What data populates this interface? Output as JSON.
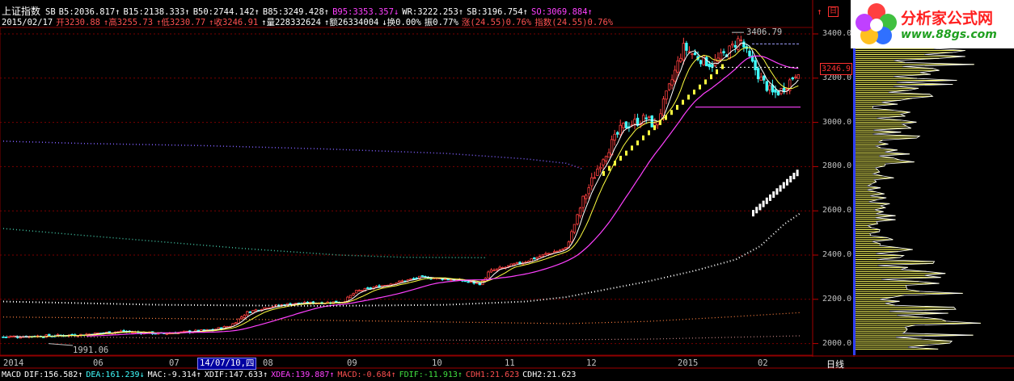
{
  "header": {
    "title": "上证指数",
    "sb_prefix": "SB",
    "items_row1": [
      {
        "label": "B5:2036.817↑",
        "color": "w"
      },
      {
        "label": "B15:2138.333↑",
        "color": "w"
      },
      {
        "label": "B50:2744.142↑",
        "color": "w"
      },
      {
        "label": "B85:3249.428↑",
        "color": "w"
      },
      {
        "label": "B95:3353.357↓",
        "color": "m"
      },
      {
        "label": "WR:3222.253↑",
        "color": "w"
      },
      {
        "label": "SB:3196.754↑",
        "color": "w"
      },
      {
        "label": "SO:3069.884↑",
        "color": "m"
      }
    ],
    "date": "2015/02/17",
    "items_row2": [
      {
        "label": "开3230.88",
        "color": "r"
      },
      {
        "label": "↑高3255.73",
        "color": "r"
      },
      {
        "label": "↑低3230.77",
        "color": "r"
      },
      {
        "label": "↑收3246.91",
        "color": "r"
      },
      {
        "label": "↑量228332624",
        "color": "w"
      },
      {
        "label": "↑额26334004",
        "color": "w"
      },
      {
        "label": "↓换0.00%",
        "color": "w"
      },
      {
        "label": "振0.77%",
        "color": "w"
      },
      {
        "label": "涨(24.55)0.76%",
        "color": "r"
      },
      {
        "label": "指数(24.55)0.76%",
        "color": "r"
      }
    ]
  },
  "controls": {
    "up_arrow": "↑",
    "box_glyph": "日"
  },
  "logo": {
    "title": "分析家公式网",
    "url": "www.88gs.com"
  },
  "y_axis": {
    "labels": [
      "3400.0",
      "3200.0",
      "3000.0",
      "2800.0",
      "2600.0",
      "2400.0",
      "2200.0",
      "2000.0"
    ]
  },
  "price_tag": "3246.9",
  "peak_label": "3406.79",
  "low_label": "1991.06",
  "x_axis": {
    "labels": [
      {
        "text": "2014",
        "pos": 4
      },
      {
        "text": "06",
        "pos": 115
      },
      {
        "text": "07",
        "pos": 209
      },
      {
        "text": "08",
        "pos": 325
      },
      {
        "text": "09",
        "pos": 429
      },
      {
        "text": "10",
        "pos": 534
      },
      {
        "text": "11",
        "pos": 624
      },
      {
        "text": "12",
        "pos": 725
      },
      {
        "text": "2015",
        "pos": 838
      },
      {
        "text": "02",
        "pos": 937
      }
    ],
    "selected": "14/07/10,四"
  },
  "period": "日线",
  "macd": [
    {
      "label": "MACD",
      "color": "w"
    },
    {
      "label": "DIF:156.582↑",
      "color": "w"
    },
    {
      "label": "DEA:161.239↓",
      "color": "c"
    },
    {
      "label": "MAC:-9.314↑",
      "color": "w"
    },
    {
      "label": "XDIF:147.633↑",
      "color": "w"
    },
    {
      "label": "XDEA:139.887↑",
      "color": "m"
    },
    {
      "label": "MACD:-0.684↑",
      "color": "r"
    },
    {
      "label": "FDIF:-11.913↑",
      "color": "g"
    },
    {
      "label": "CDH1:21.623",
      "color": "r"
    },
    {
      "label": "CDH2:21.623",
      "color": "w"
    }
  ],
  "colors": {
    "up": "#ff4040",
    "down": "#40ffff",
    "ma5": "#ffffff",
    "ma10": "#ffff40",
    "ma30": "#ff40ff",
    "grid": "#7a0000",
    "bg": "#000000"
  },
  "chart_data": {
    "type": "candlestick",
    "start": "2014-05",
    "end": "2015-02-17",
    "ylim": [
      1970,
      3470
    ],
    "notable": {
      "high": 3406.79,
      "low": 1991.06,
      "last_close": 3246.91
    },
    "key_levels": [
      2000,
      2200,
      2400,
      2600,
      2800,
      3000,
      3200,
      3400
    ]
  }
}
